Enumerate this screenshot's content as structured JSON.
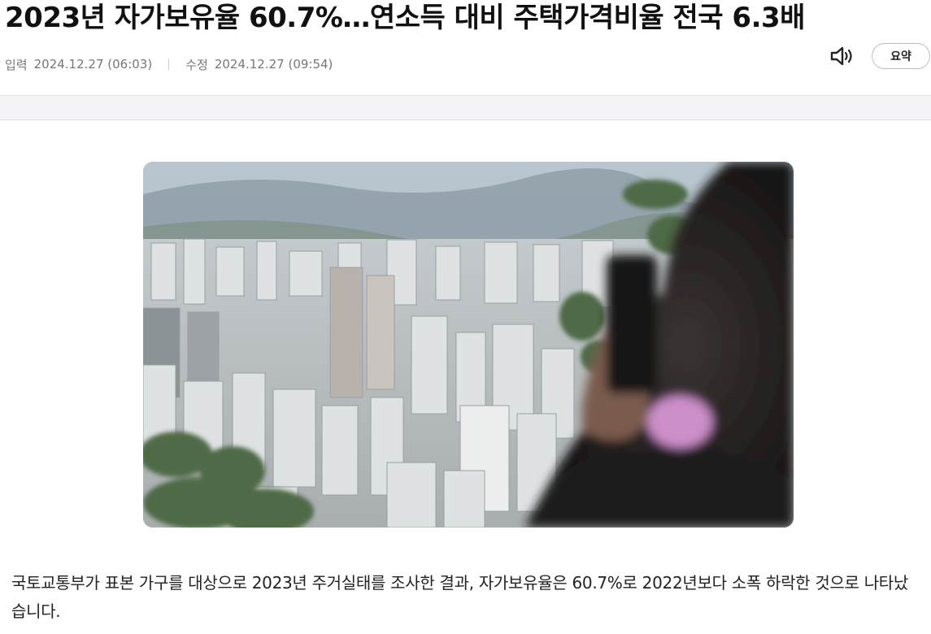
{
  "article": {
    "headline": "2023년 자가보유율 60.7%…연소득 대비 주택가격비율 전국 6.3배",
    "input_label": "입력",
    "input_datetime": "2024.12.27 (06:03)",
    "modified_label": "수정",
    "modified_datetime": "2024.12.27 (09:54)",
    "body": "국토교통부가 표본 가구를 대상으로 2023년 주거실태를 조사한 결과, 자가보유율은 60.7%로 2022년보다 소폭 하락한 것으로 나타났습니다."
  },
  "toolbar": {
    "speaker_icon": "speaker-icon",
    "summary_label": "요약"
  }
}
